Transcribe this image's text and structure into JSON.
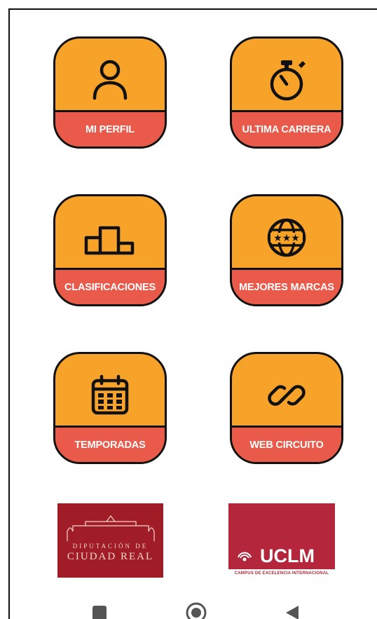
{
  "tiles": [
    {
      "label": "MI PERFIL",
      "icon": "user-icon"
    },
    {
      "label": "ULTIMA CARRERA",
      "icon": "stopwatch-icon"
    },
    {
      "label": "CLASIFICACIONES",
      "icon": "podium-icon"
    },
    {
      "label": "MEJORES MARCAS",
      "icon": "globe-stars-icon"
    },
    {
      "label": "TEMPORADAS",
      "icon": "calendar-icon"
    },
    {
      "label": "WEB CIRCUITO",
      "icon": "link-icon"
    }
  ],
  "sponsors": {
    "diputacion": {
      "line1": "DIPUTACIÓN DE",
      "line2": "CIUDAD REAL"
    },
    "uclm": {
      "name": "UCLM",
      "subtitle": "CAMPUS DE EXCELENCIA INTERNACIONAL"
    }
  },
  "colors": {
    "tile_fill": "#f7a32a",
    "tile_band": "#ea5a4b",
    "diputacion_red": "#a01c26",
    "uclm_red": "#b3263b"
  },
  "navbar": {
    "icons": [
      "recent-apps-icon",
      "home-icon",
      "back-icon"
    ]
  }
}
